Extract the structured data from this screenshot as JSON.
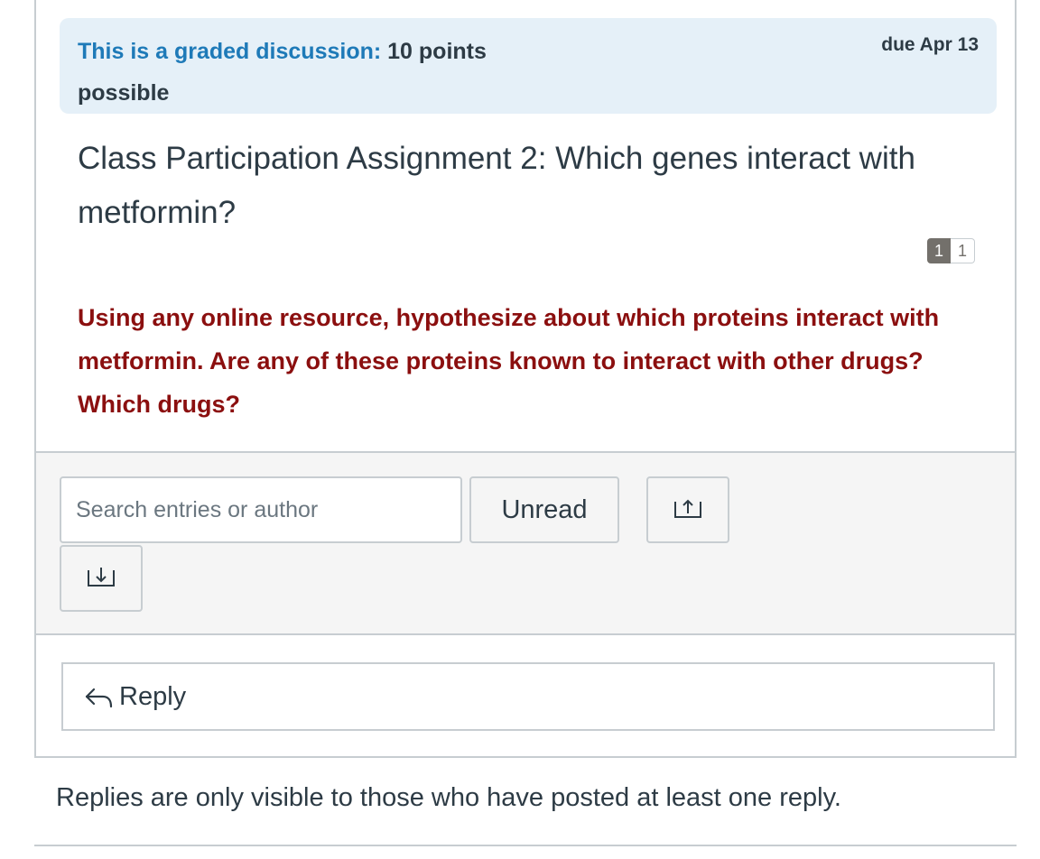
{
  "banner": {
    "graded_label": "This is a graded discussion:",
    "points": "10 points",
    "possible": "possible",
    "due": "due Apr 13"
  },
  "topic": {
    "title": "Class Participation Assignment 2: Which genes interact with metformin?",
    "unread_count": "1",
    "total_count": "1",
    "prompt": "Using any online resource, hypothesize about which proteins interact with metformin.  Are any of these proteins known to interact with other drugs? Which drugs?"
  },
  "toolbar": {
    "search_placeholder": "Search entries or author",
    "unread_label": "Unread",
    "collapse_icon": "arrow-up-box-icon",
    "expand_icon": "arrow-down-box-icon"
  },
  "reply": {
    "label": "Reply",
    "icon": "reply-arrow-icon"
  },
  "notice": {
    "text": "Replies are only visible to those who have posted at least one reply."
  },
  "colors": {
    "banner_bg": "#e5f0f8",
    "graded_label": "#1e7ab8",
    "prompt_text": "#8b0f0f",
    "toolbar_bg": "#f5f5f5",
    "border": "#c7cdd1",
    "badge": "#73706b"
  }
}
